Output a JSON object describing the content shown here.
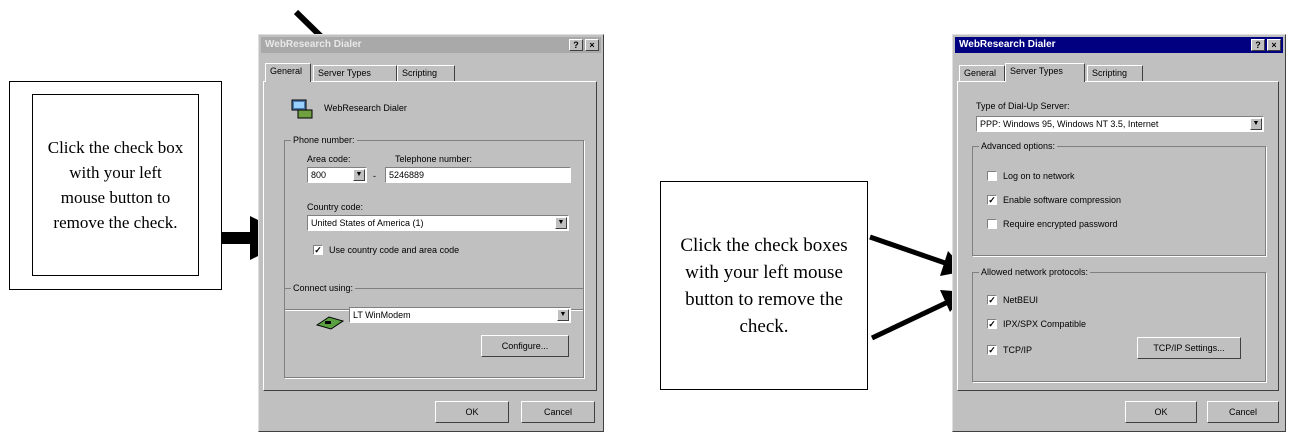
{
  "callouts": {
    "left_text": "Click the check box with your left mouse button to remove the check.",
    "right_text": "Click the check boxes with your left mouse button to remove the check."
  },
  "dialog_left": {
    "title": "WebResearch Dialer",
    "help_glyph": "?",
    "close_glyph": "×",
    "tabs": [
      "General",
      "Server Types",
      "Scripting"
    ],
    "active_tab": "General",
    "app_name": "WebResearch Dialer",
    "phone_group_label": "Phone number:",
    "area_code_label": "Area code:",
    "area_code_value": "800",
    "dash": "-",
    "telephone_label": "Telephone number:",
    "telephone_value": "5246889",
    "country_label": "Country code:",
    "country_value": "United States of America (1)",
    "use_country_label": "Use country code and area code",
    "use_country_checked": true,
    "connect_group_label": "Connect using:",
    "modem_value": "LT WinModem",
    "configure_label": "Configure...",
    "ok_label": "OK",
    "cancel_label": "Cancel",
    "colors": {
      "titlebar": "#a9a9a9"
    }
  },
  "dialog_right": {
    "title": "WebResearch Dialer",
    "help_glyph": "?",
    "close_glyph": "×",
    "tabs": [
      "General",
      "Server Types",
      "Scripting"
    ],
    "active_tab": "Server Types",
    "server_type_label": "Type of Dial-Up Server:",
    "server_type_value": "PPP: Windows 95, Windows NT 3.5, Internet",
    "advanced_group_label": "Advanced options:",
    "options": [
      {
        "label": "Log on to network",
        "checked": false
      },
      {
        "label": "Enable software compression",
        "checked": true
      },
      {
        "label": "Require encrypted password",
        "checked": false
      }
    ],
    "protocols_group_label": "Allowed network protocols:",
    "protocols": [
      {
        "label": "NetBEUI",
        "checked": true
      },
      {
        "label": "IPX/SPX Compatible",
        "checked": true
      },
      {
        "label": "TCP/IP",
        "checked": true
      }
    ],
    "tcpip_settings_label": "TCP/IP Settings...",
    "ok_label": "OK",
    "cancel_label": "Cancel",
    "colors": {
      "titlebar": "#000080"
    }
  },
  "check_glyph": "✓"
}
